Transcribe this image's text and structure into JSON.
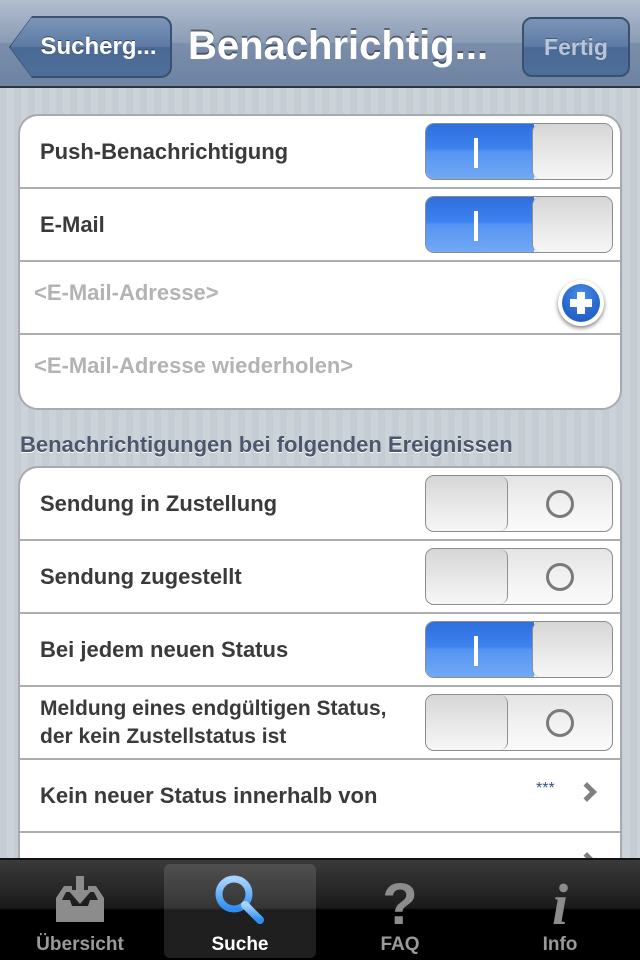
{
  "navbar": {
    "back_label": "Sucherg...",
    "title": "Benachrichtig...",
    "done_label": "Fertig"
  },
  "notification_group": {
    "push": {
      "label": "Push-Benachrichtigung",
      "value": true
    },
    "email": {
      "label": "E-Mail",
      "value": true
    },
    "email_address": {
      "placeholder": "<E-Mail-Adresse>",
      "value": ""
    },
    "email_repeat": {
      "placeholder": "<E-Mail-Adresse wiederholen>",
      "value": ""
    }
  },
  "events_section": {
    "header": "Benachrichtigungen bei folgenden Ereignissen",
    "rows": [
      {
        "label": "Sendung in Zustellung",
        "value": false
      },
      {
        "label": "Sendung zugestellt",
        "value": false
      },
      {
        "label": "Bei jedem neuen Status",
        "value": true
      },
      {
        "label": "Meldung eines endgültigen Status,",
        "label_line2": "der kein Zustellstatus ist",
        "value": false
      }
    ],
    "no_status": {
      "label": "Kein neuer Status innerhalb von",
      "value": "***"
    }
  },
  "tabbar": {
    "tabs": [
      {
        "label": "Übersicht",
        "icon": "inbox-download-icon",
        "selected": false
      },
      {
        "label": "Suche",
        "icon": "search-icon",
        "selected": true
      },
      {
        "label": "FAQ",
        "icon": "question-icon",
        "selected": false
      },
      {
        "label": "Info",
        "icon": "info-icon",
        "selected": false
      }
    ]
  },
  "colors": {
    "accent_blue": "#3d82f0",
    "navbar": "#6d83a1",
    "section_header": "#4c566c",
    "detail_value": "#385487"
  }
}
